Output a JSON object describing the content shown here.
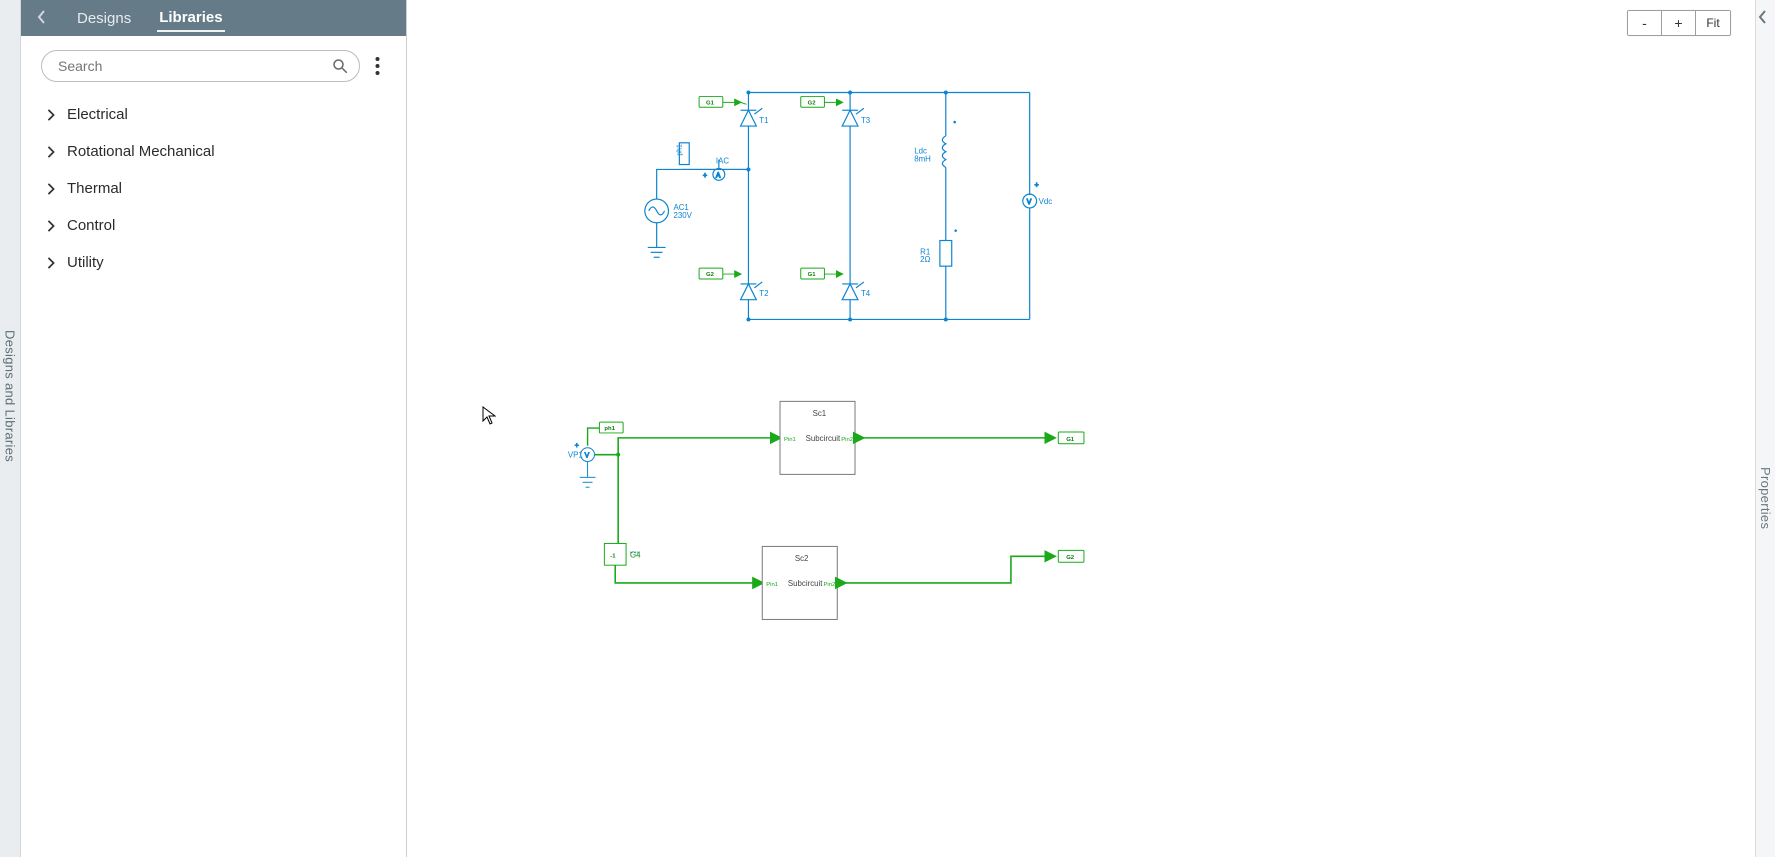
{
  "left_rail": {
    "label": "Designs and Libraries"
  },
  "right_rail": {
    "label": "Properties"
  },
  "sidebar": {
    "tabs": {
      "designs": "Designs",
      "libraries": "Libraries",
      "active": "Libraries"
    },
    "search": {
      "placeholder": "Search"
    },
    "items": [
      {
        "label": "Electrical"
      },
      {
        "label": "Rotational Mechanical"
      },
      {
        "label": "Thermal"
      },
      {
        "label": "Control"
      },
      {
        "label": "Utility"
      }
    ]
  },
  "zoom": {
    "minus": "-",
    "plus": "+",
    "fit": "Fit"
  },
  "schematic": {
    "topTags": {
      "g1": "G1",
      "g2": "G2"
    },
    "bottomTags": {
      "g2": "G2",
      "g1": "G1"
    },
    "thyristors": {
      "t1": "T1",
      "t2": "T2",
      "t3": "T3",
      "t4": "T4"
    },
    "source": {
      "name": "AC1",
      "value": "230V"
    },
    "ammeter": {
      "name": "IAC"
    },
    "phaseProbe": {
      "name": "ph1"
    },
    "inductor": {
      "name": "Ldc",
      "value": "8mH"
    },
    "resistor": {
      "name": "R1",
      "value": "2Ω"
    },
    "voltmeter": {
      "name": "Vdc"
    }
  },
  "control": {
    "phProbe": "ph1",
    "vp": "VP1",
    "gain": {
      "name": "G4",
      "value": "-1"
    },
    "sc1": {
      "name": "Sc1",
      "type": "Subcircuit",
      "pin1": "Pin1",
      "pin2": "Pin2",
      "outTag": "G1"
    },
    "sc2": {
      "name": "Sc2",
      "type": "Subcircuit",
      "pin1": "Pin1",
      "pin2": "Pin2",
      "outTag": "G2"
    }
  }
}
